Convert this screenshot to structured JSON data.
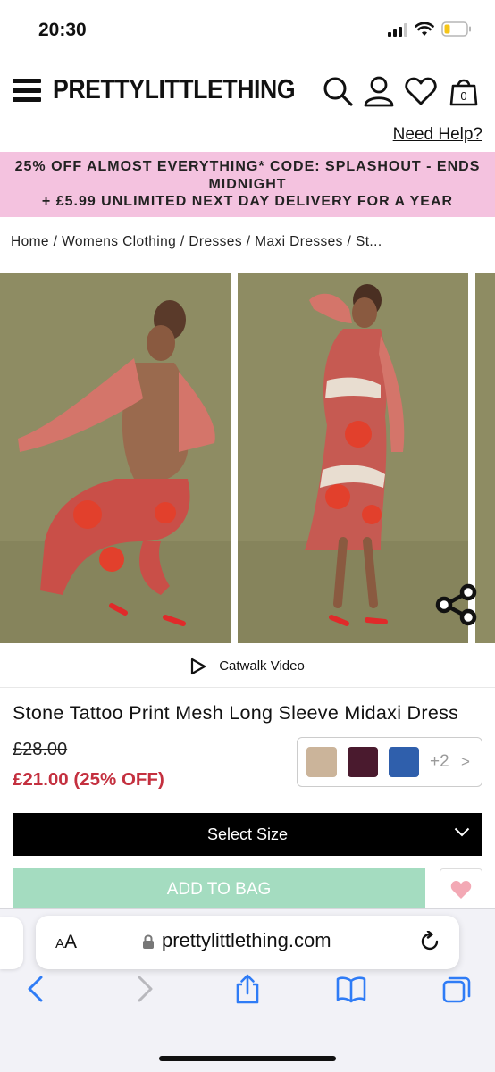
{
  "status_bar": {
    "time": "20:30"
  },
  "header": {
    "logo": "PRETTYLITTLETHING",
    "help_link": "Need Help?",
    "cart_count": "0",
    "icons": [
      "menu-icon",
      "search-icon",
      "account-icon",
      "heart-icon",
      "bag-icon"
    ]
  },
  "promo": {
    "line1": "25% OFF ALMOST EVERYTHING* CODE: SPLASHOUT - ENDS",
    "line2": "MIDNIGHT",
    "line3": "+ £5.99 UNLIMITED NEXT DAY DELIVERY FOR A YEAR"
  },
  "breadcrumb": {
    "items": [
      "Home",
      "Womens Clothing",
      "Dresses",
      "Maxi Dresses",
      "St..."
    ],
    "separator": "/"
  },
  "gallery": {
    "video_label": "Catwalk Video"
  },
  "product": {
    "title": "Stone Tattoo Print Mesh Long Sleeve Midaxi Dress",
    "old_price": "£28.00",
    "new_price": "£21.00 (25% OFF)",
    "swatches": [
      "#cbb49a",
      "#4a1a2e",
      "#2f5fac"
    ],
    "more_colors": "+2",
    "more_chevron": ">"
  },
  "actions": {
    "select_size": "Select Size",
    "add_to_bag": "ADD TO BAG"
  },
  "browser": {
    "aa_label_big": "A",
    "aa_label_small": "A",
    "url": "prettylittlething.com"
  },
  "colors": {
    "promo_bg": "#f4c2df",
    "sale_red": "#c4303f",
    "add_to_bag_bg": "#a4dcc0",
    "ios_blue": "#2f7cf6"
  }
}
